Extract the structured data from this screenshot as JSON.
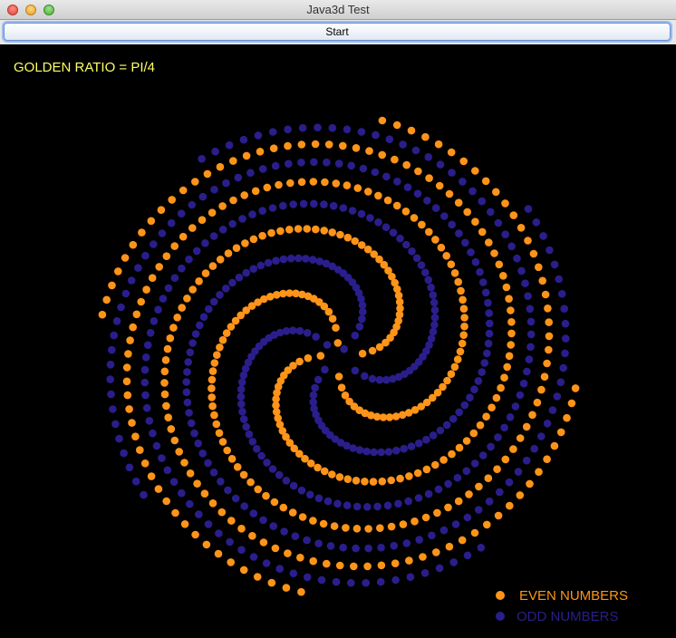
{
  "window": {
    "title": "Java3d Test"
  },
  "toolbar": {
    "start_label": "Start"
  },
  "canvas": {
    "ratio_label": "GOLDEN RATIO = PI/4",
    "legend": {
      "even_label": "EVEN NUMBERS",
      "odd_label": "ODD NUMBERS"
    }
  },
  "colors": {
    "even": "#ff9419",
    "odd": "#2a1e8c",
    "ratio_text": "#ffff66",
    "background": "#000000"
  },
  "spiral": {
    "rotation_step": "PI/4",
    "point_count": 800
  }
}
